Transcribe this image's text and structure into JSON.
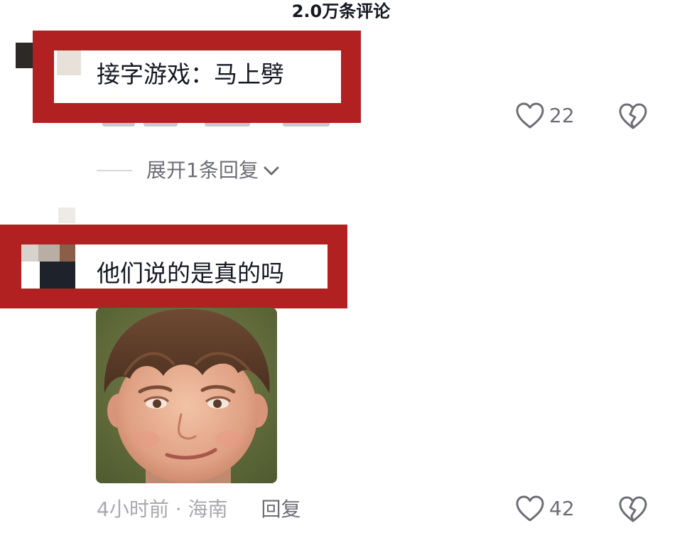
{
  "header": {
    "title": "2.0万条评论"
  },
  "comments": [
    {
      "text": "接字游戏：马上劈",
      "likes": "22",
      "expand_label": "展开1条回复"
    },
    {
      "text": "他们说的是真的吗",
      "time": "4小时前",
      "separator": "·",
      "location": "海南",
      "reply_label": "回复",
      "likes": "42"
    }
  ],
  "icons": {
    "like": "heart-outline-icon",
    "dislike": "broken-heart-icon",
    "expand": "chevron-down-icon"
  },
  "colors": {
    "highlight_box": "#b22121",
    "primary_text": "#161823",
    "secondary_text": "#6d6e76",
    "tertiary_text": "#a8a9ae"
  }
}
